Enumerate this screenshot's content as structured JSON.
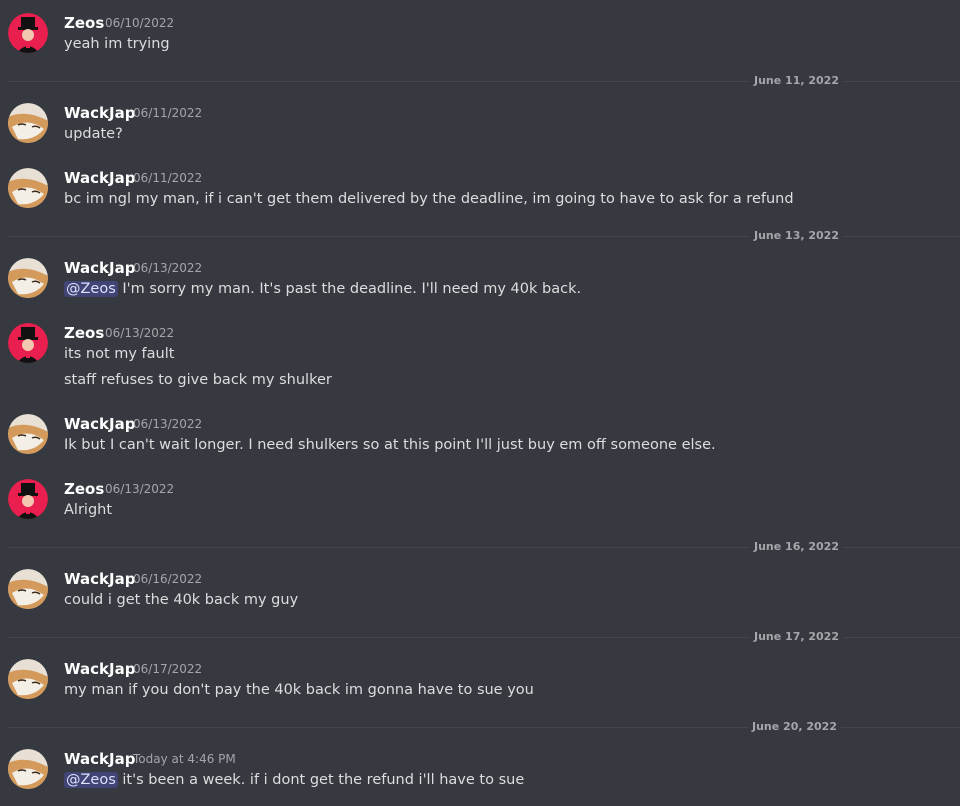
{
  "users": {
    "zeos": "Zeos",
    "wackjap": "WackJap"
  },
  "icons": {
    "zeos_avatar": "zeos-avatar-icon",
    "wackjap_avatar": "shiba-avatar-icon"
  },
  "colors": {
    "background": "#36393f",
    "username": "#ffffff",
    "mention_bg": "#414675",
    "zeos_avatar_bg": "#e9204f"
  },
  "messages": [
    {
      "author": "Zeos",
      "time": "06/10/2022",
      "lines": [
        "yeah im trying"
      ]
    },
    {
      "author": "WackJap",
      "time": "06/11/2022",
      "lines": [
        "update?"
      ]
    },
    {
      "author": "WackJap",
      "time": "06/11/2022",
      "lines": [
        "bc im ngl my man, if i can't get them delivered by the deadline, im going to have to ask for a refund"
      ]
    },
    {
      "author": "WackJap",
      "time": "06/13/2022",
      "mention": "@Zeos",
      "lines": [
        "I'm sorry my man. It's past the deadline. I'll need my 40k back."
      ]
    },
    {
      "author": "Zeos",
      "time": "06/13/2022",
      "lines": [
        "its not my fault",
        "staff refuses to give back my shulker"
      ]
    },
    {
      "author": "WackJap",
      "time": "06/13/2022",
      "lines": [
        "Ik but I can't wait longer. I need shulkers so at this point I'll just buy em off someone else."
      ]
    },
    {
      "author": "Zeos",
      "time": "06/13/2022",
      "lines": [
        "Alright"
      ]
    },
    {
      "author": "WackJap",
      "time": "06/16/2022",
      "lines": [
        "could i get the 40k back my guy"
      ]
    },
    {
      "author": "WackJap",
      "time": "06/17/2022",
      "lines": [
        "my man if you don't pay the 40k back im gonna have to sue you"
      ]
    },
    {
      "author": "WackJap",
      "time": "Today at 4:46 PM",
      "mention": "@Zeos",
      "lines": [
        "it's been a week. if i dont get the refund i'll have to sue"
      ]
    }
  ],
  "dividers": [
    "June 11, 2022",
    "June 13, 2022",
    "June 16, 2022",
    "June 17, 2022",
    "June 20, 2022"
  ]
}
